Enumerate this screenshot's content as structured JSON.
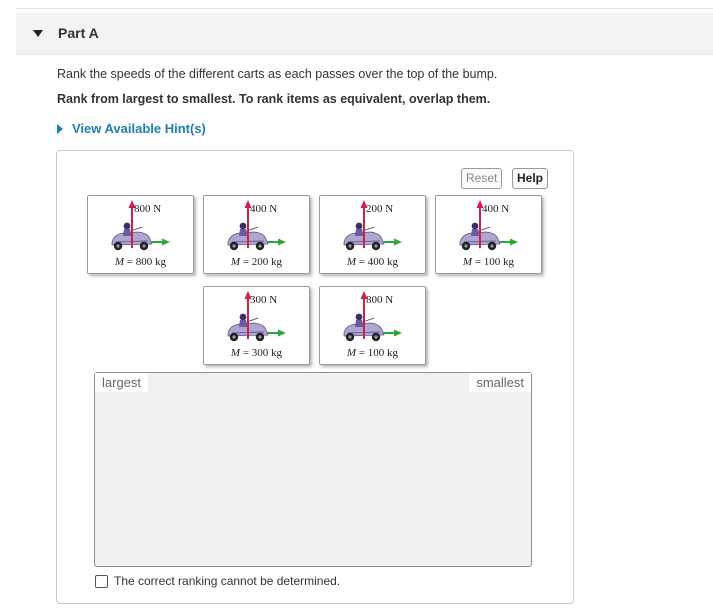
{
  "part": {
    "title": "Part A"
  },
  "instructions": {
    "line1": "Rank the speeds of the different carts as each passes over the top of the bump.",
    "line2": "Rank from largest to smallest. To rank items as equivalent, overlap them."
  },
  "hint": {
    "label": "View Available Hint(s)"
  },
  "buttons": {
    "reset": "Reset",
    "help": "Help"
  },
  "cards": [
    {
      "force": "800 N",
      "mass_label": "M",
      "mass_value": " = 800 kg"
    },
    {
      "force": "400 N",
      "mass_label": "M",
      "mass_value": " = 200 kg"
    },
    {
      "force": "200 N",
      "mass_label": "M",
      "mass_value": " = 400 kg"
    },
    {
      "force": "400 N",
      "mass_label": "M",
      "mass_value": " = 100 kg"
    },
    {
      "force": "300 N",
      "mass_label": "M",
      "mass_value": " = 300 kg"
    },
    {
      "force": "800 N",
      "mass_label": "M",
      "mass_value": " = 100 kg"
    }
  ],
  "ranking": {
    "largest": "largest",
    "smallest": "smallest"
  },
  "checkbox": {
    "label": "The correct ranking cannot be determined.",
    "checked": false
  },
  "colors": {
    "hint_blue": "#1d7fb3",
    "force_arrow": "#d0204a",
    "velocity_arrow": "#2aa63a",
    "cart": "#8a7ab8"
  }
}
